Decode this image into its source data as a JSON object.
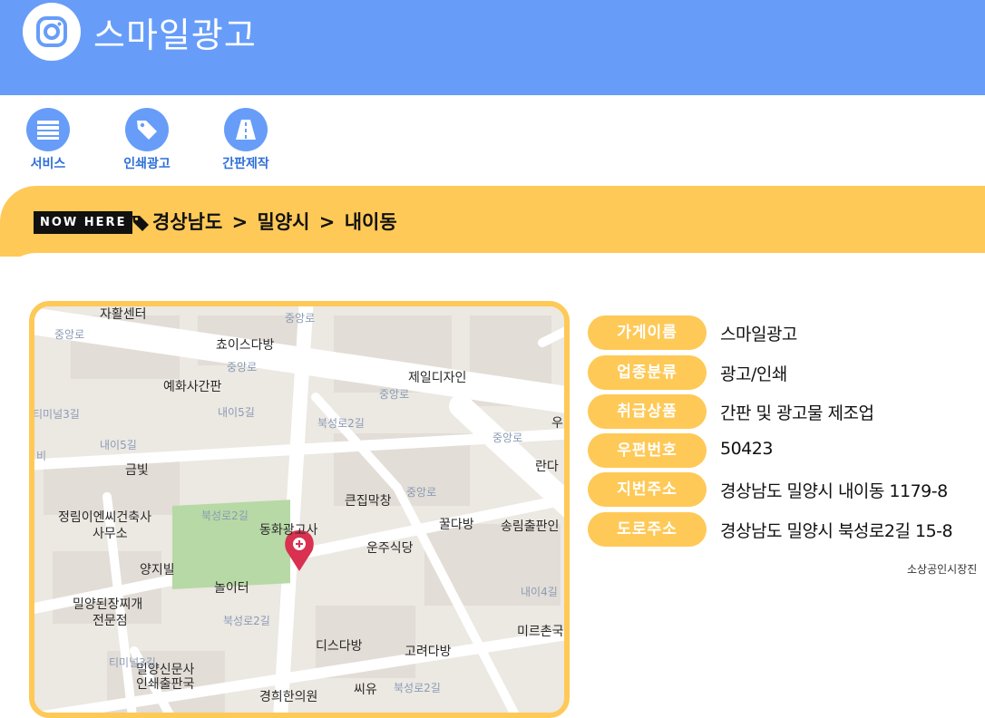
{
  "header": {
    "brand": "스마일광고"
  },
  "nav": [
    {
      "label": "서비스",
      "icon": "list-icon"
    },
    {
      "label": "인쇄광고",
      "icon": "tag-icon"
    },
    {
      "label": "간판제작",
      "icon": "road-icon"
    }
  ],
  "location": {
    "badge": "NOW HERE",
    "crumbs": [
      "경상남도",
      ">",
      "밀양시",
      ">",
      "내이동"
    ]
  },
  "map": {
    "places": [
      "자활센터",
      "쵸이스다방",
      "예화사간판",
      "제일디자인",
      "금빛",
      "큰집막창",
      "정림이엔씨건축사",
      "사무소",
      "동화광고사",
      "꿀다방",
      "송림출판인",
      "운주식당",
      "양지빌",
      "놀이터",
      "밀양된장찌개",
      "전문점",
      "디스다방",
      "고려다방",
      "미르촌국",
      "밀양신문사",
      "인쇄출판국",
      "경희한의원",
      "씨유",
      "우",
      "란다"
    ],
    "roads": [
      "중앙로",
      "중앙로",
      "중앙로",
      "중앙로",
      "중앙로",
      "내이5길",
      "내이5길",
      "북성로2길",
      "북성로2길",
      "북성로2길",
      "북성로2길",
      "내이4길",
      "티미널3길",
      "티미널3길",
      "중앙로",
      "비"
    ]
  },
  "info": [
    {
      "label": "가게이름",
      "value": "스마일광고"
    },
    {
      "label": "업종분류",
      "value": "광고/인쇄"
    },
    {
      "label": "취급상품",
      "value": "간판 및 광고물 제조업"
    },
    {
      "label": "우편번호",
      "value": "50423"
    },
    {
      "label": "지번주소",
      "value": "경상남도 밀양시 내이동 1179-8"
    },
    {
      "label": "도로주소",
      "value": "경상남도 밀양시 북성로2길 15-8"
    }
  ],
  "source_note": "소상공인시장진",
  "colors": {
    "primary": "#679df9",
    "accent": "#fec957",
    "pin": "#d93150"
  }
}
